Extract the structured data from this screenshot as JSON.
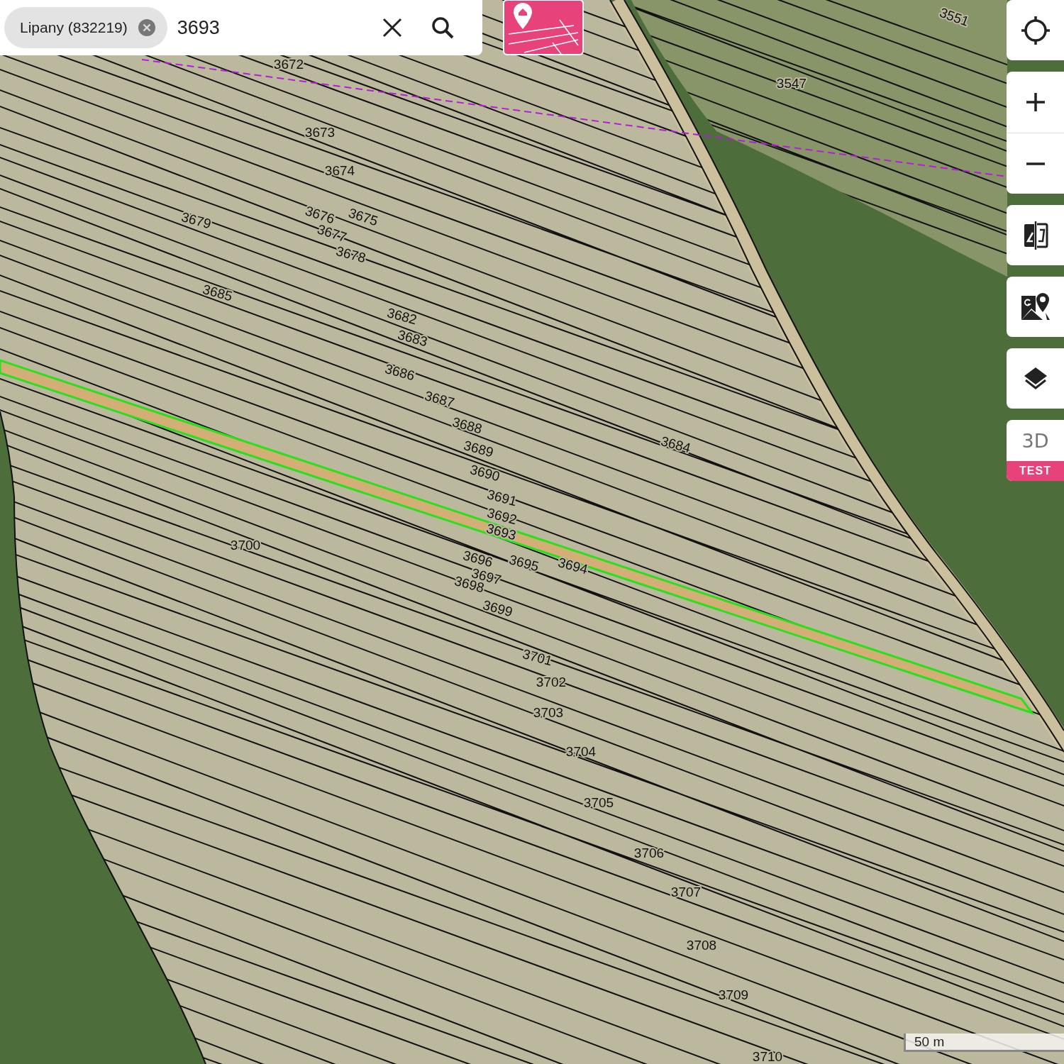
{
  "search": {
    "area_chip": "Lipany (832219)",
    "value": "3693"
  },
  "map": {
    "highlight_selected_parcel": true,
    "parcel_labels": [
      "3551",
      "3672",
      "3547",
      "3673",
      "3674",
      "3679",
      "3676",
      "3675",
      "3677",
      "3678",
      "3685",
      "3682",
      "3683",
      "3686",
      "3687",
      "3684",
      "3688",
      "3689",
      "3690",
      "3691",
      "3692",
      "3693",
      "3700",
      "3696",
      "3695",
      "3694",
      "3697",
      "3698",
      "3699",
      "3701",
      "3702",
      "3703",
      "3704",
      "3705",
      "3706",
      "3707",
      "3708",
      "3709",
      "3710"
    ]
  },
  "controls": {
    "three_d": "3D",
    "three_d_badge": "TEST"
  },
  "scale": "50 m"
}
